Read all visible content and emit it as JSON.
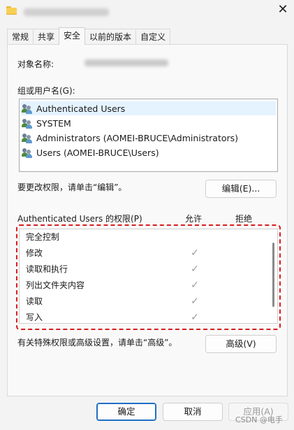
{
  "window": {
    "title_icon": "folder-icon",
    "close_icon": "close-icon"
  },
  "tabs": [
    {
      "label": "常规"
    },
    {
      "label": "共享"
    },
    {
      "label": "安全"
    },
    {
      "label": "以前的版本"
    },
    {
      "label": "自定义"
    }
  ],
  "active_tab": "安全",
  "object": {
    "label": "对象名称:"
  },
  "groups": {
    "label": "组或用户名(G):",
    "items": [
      {
        "name": "Authenticated Users",
        "icon": "users-icon"
      },
      {
        "name": "SYSTEM",
        "icon": "users-icon"
      },
      {
        "name": "Administrators (AOMEI-BRUCE\\Administrators)",
        "icon": "users-icon"
      },
      {
        "name": "Users (AOMEI-BRUCE\\Users)",
        "icon": "users-icon"
      }
    ],
    "selected_index": 0
  },
  "edit": {
    "hint": "要更改权限，请单击“编辑”。",
    "button": "编辑(E)..."
  },
  "permissions": {
    "header": "Authenticated Users 的权限(P)",
    "allow_header": "允许",
    "deny_header": "拒绝",
    "items": [
      {
        "name": "完全控制",
        "allow": false
      },
      {
        "name": "修改",
        "allow": true
      },
      {
        "name": "读取和执行",
        "allow": true
      },
      {
        "name": "列出文件夹内容",
        "allow": true
      },
      {
        "name": "读取",
        "allow": true
      },
      {
        "name": "写入",
        "allow": true
      }
    ],
    "check_glyph": "✓"
  },
  "advanced": {
    "hint": "有关特殊权限或高级设置，请单击“高级”。",
    "button": "高级(V)"
  },
  "footer": {
    "ok": "确定",
    "cancel": "取消",
    "apply": "应用(A)"
  },
  "watermark": "CSDN @电手",
  "colors": {
    "highlight_box": "#d81e1e",
    "selected_row": "#e5f3ff",
    "primary_border": "#1f6fc5"
  }
}
